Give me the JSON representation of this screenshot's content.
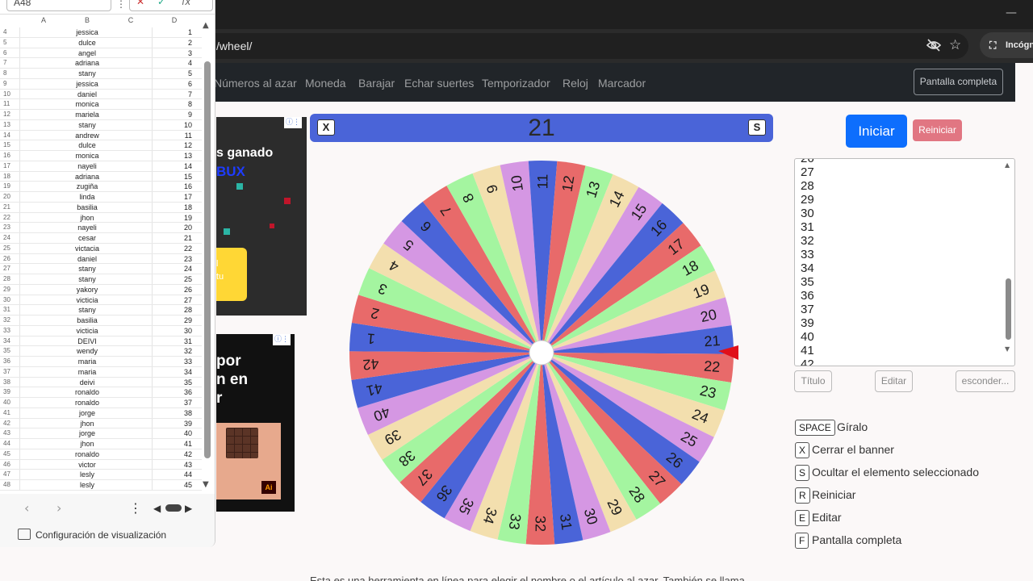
{
  "browser": {
    "url_fragment": "/wheel/",
    "incognito_label": "Incógnito"
  },
  "nav": {
    "items": [
      "Números al azar",
      "Moneda",
      "Barajar",
      "Echar suertes",
      "Temporizador",
      "Reloj",
      "Marcador"
    ],
    "fullscreen_label": "Pantalla completa"
  },
  "ads": {
    "ad1_line1": "s ganado",
    "ad1_line2": "BUX",
    "ad1_yellow_text": "l\ntu",
    "ad2_text": "por\nn en\nr",
    "ad2_logo": "Ai"
  },
  "spreadsheet": {
    "namebox": "A48",
    "col_headers": [
      "A",
      "B",
      "C",
      "D"
    ],
    "rows": [
      {
        "n": "4",
        "name": "jessica",
        "num": "1"
      },
      {
        "n": "5",
        "name": "dulce",
        "num": "2"
      },
      {
        "n": "6",
        "name": "angel",
        "num": "3"
      },
      {
        "n": "7",
        "name": "adriana",
        "num": "4"
      },
      {
        "n": "8",
        "name": "stany",
        "num": "5"
      },
      {
        "n": "9",
        "name": "jessica",
        "num": "6"
      },
      {
        "n": "10",
        "name": "daniel",
        "num": "7"
      },
      {
        "n": "11",
        "name": "monica",
        "num": "8"
      },
      {
        "n": "12",
        "name": "mariela",
        "num": "9"
      },
      {
        "n": "13",
        "name": "stany",
        "num": "10"
      },
      {
        "n": "14",
        "name": "andrew",
        "num": "11"
      },
      {
        "n": "15",
        "name": "dulce",
        "num": "12"
      },
      {
        "n": "16",
        "name": "monica",
        "num": "13"
      },
      {
        "n": "17",
        "name": "nayeli",
        "num": "14"
      },
      {
        "n": "18",
        "name": "adriana",
        "num": "15"
      },
      {
        "n": "19",
        "name": "zugiña",
        "num": "16"
      },
      {
        "n": "20",
        "name": "linda",
        "num": "17"
      },
      {
        "n": "21",
        "name": "basilia",
        "num": "18"
      },
      {
        "n": "22",
        "name": "jhon",
        "num": "19"
      },
      {
        "n": "23",
        "name": "nayeli",
        "num": "20"
      },
      {
        "n": "24",
        "name": "cesar",
        "num": "21"
      },
      {
        "n": "25",
        "name": "victacia",
        "num": "22"
      },
      {
        "n": "26",
        "name": "daniel",
        "num": "23"
      },
      {
        "n": "27",
        "name": "stany",
        "num": "24"
      },
      {
        "n": "28",
        "name": "stany",
        "num": "25"
      },
      {
        "n": "29",
        "name": "yakory",
        "num": "26"
      },
      {
        "n": "30",
        "name": "victicia",
        "num": "27"
      },
      {
        "n": "31",
        "name": "stany",
        "num": "28"
      },
      {
        "n": "32",
        "name": "basilia",
        "num": "29"
      },
      {
        "n": "33",
        "name": "victicia",
        "num": "30"
      },
      {
        "n": "34",
        "name": "DEIVI",
        "num": "31"
      },
      {
        "n": "35",
        "name": "wendy",
        "num": "32"
      },
      {
        "n": "36",
        "name": "maria",
        "num": "33"
      },
      {
        "n": "37",
        "name": "maria",
        "num": "34"
      },
      {
        "n": "38",
        "name": "deivi",
        "num": "35"
      },
      {
        "n": "39",
        "name": "ronaldo",
        "num": "36"
      },
      {
        "n": "40",
        "name": "ronaldo",
        "num": "37"
      },
      {
        "n": "41",
        "name": "jorge",
        "num": "38"
      },
      {
        "n": "42",
        "name": "jhon",
        "num": "39"
      },
      {
        "n": "43",
        "name": "jorge",
        "num": "40"
      },
      {
        "n": "44",
        "name": "jhon",
        "num": "41"
      },
      {
        "n": "45",
        "name": "ronaldo",
        "num": "42"
      },
      {
        "n": "46",
        "name": "victor",
        "num": "43"
      },
      {
        "n": "47",
        "name": "lesly",
        "num": "44"
      },
      {
        "n": "48",
        "name": "lesly",
        "num": "45"
      }
    ],
    "config_label": "Configuración de visualización"
  },
  "wheel": {
    "result": "21",
    "close_key": "X",
    "hide_key": "S",
    "segment_count": 42,
    "colors": [
      "#4a64d8",
      "#e86a6a",
      "#a4f5a0",
      "#f3dfae",
      "#d597e3"
    ],
    "pointer_color": "#e0101a"
  },
  "controls": {
    "start_label": "Iniciar",
    "reset_label": "Reiniciar",
    "entries": [
      "26",
      "27",
      "28",
      "29",
      "30",
      "31",
      "32",
      "33",
      "34",
      "35",
      "36",
      "37",
      "39",
      "40",
      "41",
      "42"
    ],
    "title_button": "Título",
    "edit_button": "Editar",
    "hide_button": "esconder..."
  },
  "shortcuts": [
    {
      "key": "SPACE",
      "label": "Gíralo"
    },
    {
      "key": "X",
      "label": "Cerrar el banner"
    },
    {
      "key": "S",
      "label": "Ocultar el elemento seleccionado"
    },
    {
      "key": "R",
      "label": "Reiniciar"
    },
    {
      "key": "E",
      "label": "Editar"
    },
    {
      "key": "F",
      "label": "Pantalla completa"
    }
  ],
  "footer": "Esta es una herramienta en línea para elegir el nombre o el artículo al azar. También se llama"
}
